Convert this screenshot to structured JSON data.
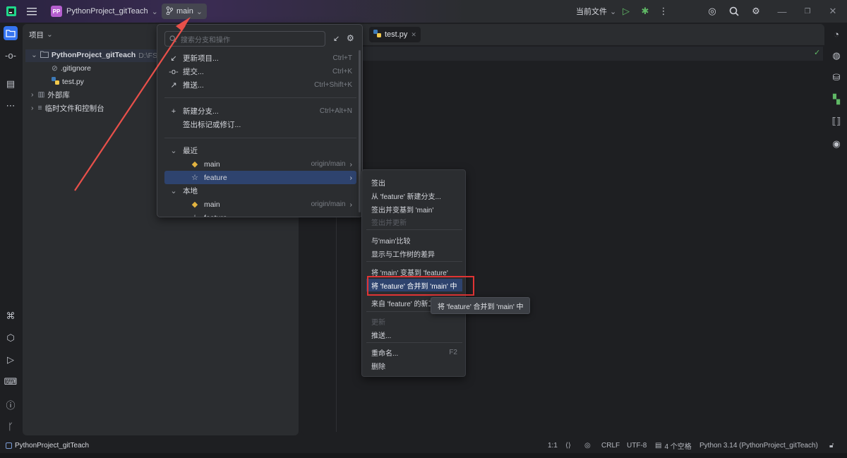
{
  "titlebar": {
    "project_badge": "PP",
    "project_name": "PythonProject_gitTeach",
    "branch": "main",
    "run_config": "当前文件"
  },
  "project_panel": {
    "header": "项目",
    "root": "PythonProject_gitTeach",
    "root_path": "D:\\FS学",
    "files": [
      ".gitignore",
      "test.py"
    ],
    "ext_libs": "外部库",
    "scratches": "临时文件和控制台"
  },
  "editor": {
    "tab": "test.py"
  },
  "branch_popup": {
    "search_placeholder": "搜索分支和操作",
    "actions": [
      {
        "label": "更新项目...",
        "shortcut": "Ctrl+T"
      },
      {
        "label": "提交...",
        "shortcut": "Ctrl+K"
      },
      {
        "label": "推送...",
        "shortcut": "Ctrl+Shift+K"
      },
      {
        "label": "新建分支...",
        "shortcut": "Ctrl+Alt+N"
      },
      {
        "label": "签出标记或修订...",
        "shortcut": ""
      }
    ],
    "recent_header": "最近",
    "recent": [
      {
        "name": "main",
        "remote": "origin/main"
      },
      {
        "name": "feature",
        "remote": ""
      }
    ],
    "local_header": "本地",
    "local": [
      {
        "name": "main",
        "remote": "origin/main"
      },
      {
        "name": "feature",
        "remote": ""
      }
    ]
  },
  "submenu": {
    "items": [
      {
        "label": "签出",
        "shortcut": "",
        "disabled": false
      },
      {
        "label": "从 'feature' 新建分支...",
        "shortcut": "",
        "disabled": false
      },
      {
        "label": "签出并变基到 'main'",
        "shortcut": "",
        "disabled": false
      },
      {
        "label": "签出并更新",
        "shortcut": "",
        "disabled": true
      },
      {
        "label": "与'main'比较",
        "shortcut": "",
        "disabled": false
      },
      {
        "label": "显示与工作树的差异",
        "shortcut": "",
        "disabled": false
      },
      {
        "label": "将 'main' 变基到 'feature'",
        "shortcut": "",
        "disabled": false
      },
      {
        "label": "将 'feature' 合并到 'main' 中",
        "shortcut": "",
        "disabled": false
      },
      {
        "label": "来自 'feature' 的新工",
        "shortcut": "",
        "disabled": false
      },
      {
        "label": "更新",
        "shortcut": "",
        "disabled": true
      },
      {
        "label": "推送...",
        "shortcut": "",
        "disabled": false
      },
      {
        "label": "重命名...",
        "shortcut": "F2",
        "disabled": false
      },
      {
        "label": "删除",
        "shortcut": "",
        "disabled": false
      }
    ],
    "tooltip": "将 'feature' 合并到 'main' 中"
  },
  "statusbar": {
    "project": "PythonProject_gitTeach",
    "position": "1:1",
    "line_sep": "CRLF",
    "encoding": "UTF-8",
    "indent": "4 个空格",
    "interpreter": "Python 3.14 (PythonProject_gitTeach)"
  },
  "colors": {
    "accent": "#3574f0",
    "selection": "#2e436e",
    "highlight_box": "#e03434",
    "annotation_arrow": "#e8504a"
  }
}
